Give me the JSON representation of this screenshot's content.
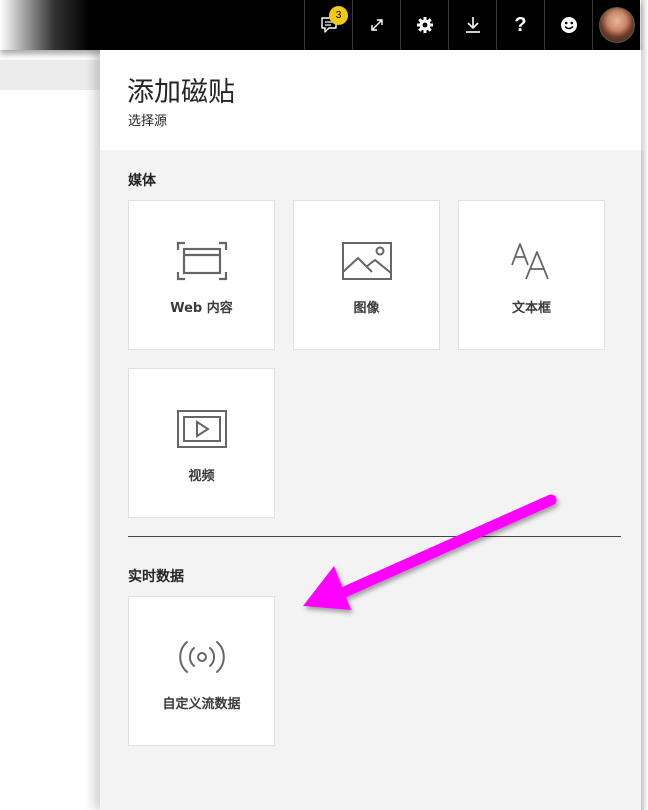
{
  "topbar": {
    "notifications": {
      "icon": "comment-icon",
      "badge_count": "3",
      "badge_color": "#f2c811"
    },
    "buttons": [
      {
        "name": "expand-button",
        "icon": "expand-icon"
      },
      {
        "name": "settings-button",
        "icon": "gear-icon"
      },
      {
        "name": "download-button",
        "icon": "download-icon"
      },
      {
        "name": "help-button",
        "icon": "help-icon",
        "glyph": "?"
      },
      {
        "name": "feedback-button",
        "icon": "smiley-icon"
      },
      {
        "name": "account-button",
        "icon": "avatar"
      }
    ]
  },
  "panel": {
    "title": "添加磁贴",
    "subtitle": "选择源",
    "sections": [
      {
        "label": "媒体",
        "tiles": [
          {
            "label": "Web 内容",
            "icon": "web-content-icon"
          },
          {
            "label": "图像",
            "icon": "image-icon"
          },
          {
            "label": "文本框",
            "icon": "text-box-icon"
          },
          {
            "label": "视频",
            "icon": "video-icon"
          }
        ]
      },
      {
        "label": "实时数据",
        "tiles": [
          {
            "label": "自定义流数据",
            "icon": "streaming-data-icon"
          }
        ]
      }
    ]
  },
  "annotation": {
    "icon": "arrow-annotation",
    "color": "#ff00ff"
  }
}
